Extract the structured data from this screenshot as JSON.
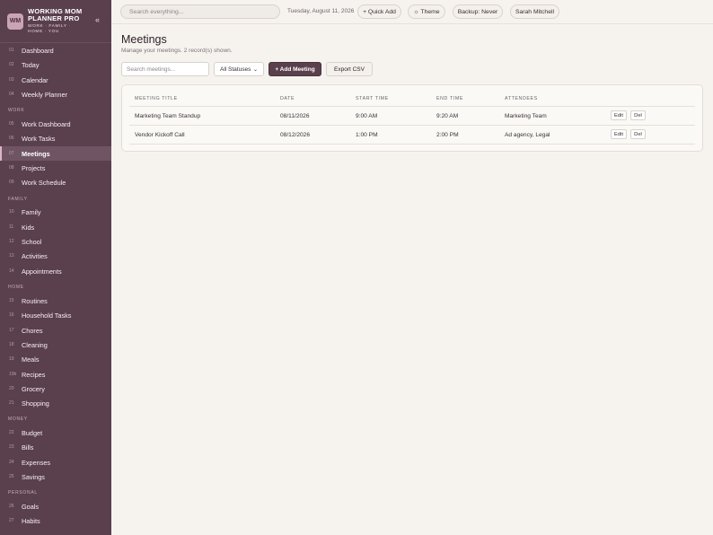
{
  "sidebar": {
    "logo": "WM",
    "title_line1": "WORKING MOM",
    "title_line2": "PLANNER PRO",
    "subtitle_line1": "WORK · FAMILY ·",
    "subtitle_line2": "HOME · YOU",
    "collapse_icon": "«",
    "sections": [
      "WORK",
      "FAMILY",
      "HOME",
      "MONEY",
      "PERSONAL"
    ],
    "items": [
      {
        "num": "01",
        "label": "Dashboard"
      },
      {
        "num": "02",
        "label": "Today"
      },
      {
        "num": "03",
        "label": "Calendar"
      },
      {
        "num": "04",
        "label": "Weekly Planner"
      },
      {
        "num": "05",
        "label": "Work Dashboard"
      },
      {
        "num": "06",
        "label": "Work Tasks"
      },
      {
        "num": "07",
        "label": "Meetings"
      },
      {
        "num": "08",
        "label": "Projects"
      },
      {
        "num": "09",
        "label": "Work Schedule"
      },
      {
        "num": "10",
        "label": "Family"
      },
      {
        "num": "11",
        "label": "Kids"
      },
      {
        "num": "12",
        "label": "School"
      },
      {
        "num": "13",
        "label": "Activities"
      },
      {
        "num": "14",
        "label": "Appointments"
      },
      {
        "num": "15",
        "label": "Routines"
      },
      {
        "num": "16",
        "label": "Household Tasks"
      },
      {
        "num": "17",
        "label": "Chores"
      },
      {
        "num": "18",
        "label": "Cleaning"
      },
      {
        "num": "19",
        "label": "Meals"
      },
      {
        "num": "19b",
        "label": "Recipes"
      },
      {
        "num": "20",
        "label": "Grocery"
      },
      {
        "num": "21",
        "label": "Shopping"
      },
      {
        "num": "22",
        "label": "Budget"
      },
      {
        "num": "23",
        "label": "Bills"
      },
      {
        "num": "24",
        "label": "Expenses"
      },
      {
        "num": "25",
        "label": "Savings"
      },
      {
        "num": "26",
        "label": "Goals"
      },
      {
        "num": "27",
        "label": "Habits"
      }
    ]
  },
  "topbar": {
    "search_placeholder": "Search everything...",
    "date": "Tuesday, August 11, 2026",
    "quick_add": "+ Quick Add",
    "theme": "☼ Theme",
    "backup": "Backup: Never",
    "user": "Sarah Mitchell"
  },
  "main": {
    "title": "Meetings",
    "subtitle": "Manage your meetings. 2 record(s) shown.",
    "search_placeholder": "Search meetings...",
    "status_filter": "All Statuses",
    "add_button": "+ Add Meeting",
    "export_button": "Export CSV",
    "columns": [
      "MEETING TITLE",
      "DATE",
      "START TIME",
      "END TIME",
      "ATTENDEES"
    ],
    "rows": [
      {
        "title": "Marketing Team Standup",
        "date": "08/11/2026",
        "start": "9:00 AM",
        "end": "9:20 AM",
        "attendees": "Marketing Team"
      },
      {
        "title": "Vendor Kickoff Call",
        "date": "08/12/2026",
        "start": "1:00 PM",
        "end": "2:00 PM",
        "attendees": "Ad agency, Legal"
      }
    ],
    "edit_label": "Edit",
    "delete_label": "Del"
  },
  "colors": {
    "sidebar_bg": "#5a3f4d",
    "accent": "#5a3f4d",
    "page_bg": "#f6f3ef"
  }
}
